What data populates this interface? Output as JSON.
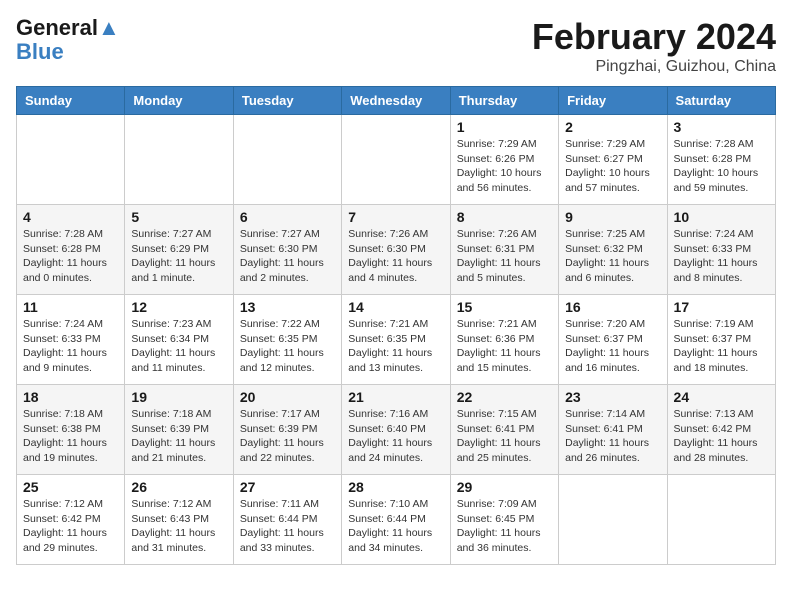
{
  "header": {
    "logo_line1": "General",
    "logo_line2": "Blue",
    "month_year": "February 2024",
    "location": "Pingzhai, Guizhou, China"
  },
  "days_of_week": [
    "Sunday",
    "Monday",
    "Tuesday",
    "Wednesday",
    "Thursday",
    "Friday",
    "Saturday"
  ],
  "weeks": [
    [
      {
        "day": "",
        "sunrise": "",
        "sunset": "",
        "daylight": ""
      },
      {
        "day": "",
        "sunrise": "",
        "sunset": "",
        "daylight": ""
      },
      {
        "day": "",
        "sunrise": "",
        "sunset": "",
        "daylight": ""
      },
      {
        "day": "",
        "sunrise": "",
        "sunset": "",
        "daylight": ""
      },
      {
        "day": "1",
        "sunrise": "7:29 AM",
        "sunset": "6:26 PM",
        "daylight": "10 hours and 56 minutes."
      },
      {
        "day": "2",
        "sunrise": "7:29 AM",
        "sunset": "6:27 PM",
        "daylight": "10 hours and 57 minutes."
      },
      {
        "day": "3",
        "sunrise": "7:28 AM",
        "sunset": "6:28 PM",
        "daylight": "10 hours and 59 minutes."
      }
    ],
    [
      {
        "day": "4",
        "sunrise": "7:28 AM",
        "sunset": "6:28 PM",
        "daylight": "11 hours and 0 minutes."
      },
      {
        "day": "5",
        "sunrise": "7:27 AM",
        "sunset": "6:29 PM",
        "daylight": "11 hours and 1 minute."
      },
      {
        "day": "6",
        "sunrise": "7:27 AM",
        "sunset": "6:30 PM",
        "daylight": "11 hours and 2 minutes."
      },
      {
        "day": "7",
        "sunrise": "7:26 AM",
        "sunset": "6:30 PM",
        "daylight": "11 hours and 4 minutes."
      },
      {
        "day": "8",
        "sunrise": "7:26 AM",
        "sunset": "6:31 PM",
        "daylight": "11 hours and 5 minutes."
      },
      {
        "day": "9",
        "sunrise": "7:25 AM",
        "sunset": "6:32 PM",
        "daylight": "11 hours and 6 minutes."
      },
      {
        "day": "10",
        "sunrise": "7:24 AM",
        "sunset": "6:33 PM",
        "daylight": "11 hours and 8 minutes."
      }
    ],
    [
      {
        "day": "11",
        "sunrise": "7:24 AM",
        "sunset": "6:33 PM",
        "daylight": "11 hours and 9 minutes."
      },
      {
        "day": "12",
        "sunrise": "7:23 AM",
        "sunset": "6:34 PM",
        "daylight": "11 hours and 11 minutes."
      },
      {
        "day": "13",
        "sunrise": "7:22 AM",
        "sunset": "6:35 PM",
        "daylight": "11 hours and 12 minutes."
      },
      {
        "day": "14",
        "sunrise": "7:21 AM",
        "sunset": "6:35 PM",
        "daylight": "11 hours and 13 minutes."
      },
      {
        "day": "15",
        "sunrise": "7:21 AM",
        "sunset": "6:36 PM",
        "daylight": "11 hours and 15 minutes."
      },
      {
        "day": "16",
        "sunrise": "7:20 AM",
        "sunset": "6:37 PM",
        "daylight": "11 hours and 16 minutes."
      },
      {
        "day": "17",
        "sunrise": "7:19 AM",
        "sunset": "6:37 PM",
        "daylight": "11 hours and 18 minutes."
      }
    ],
    [
      {
        "day": "18",
        "sunrise": "7:18 AM",
        "sunset": "6:38 PM",
        "daylight": "11 hours and 19 minutes."
      },
      {
        "day": "19",
        "sunrise": "7:18 AM",
        "sunset": "6:39 PM",
        "daylight": "11 hours and 21 minutes."
      },
      {
        "day": "20",
        "sunrise": "7:17 AM",
        "sunset": "6:39 PM",
        "daylight": "11 hours and 22 minutes."
      },
      {
        "day": "21",
        "sunrise": "7:16 AM",
        "sunset": "6:40 PM",
        "daylight": "11 hours and 24 minutes."
      },
      {
        "day": "22",
        "sunrise": "7:15 AM",
        "sunset": "6:41 PM",
        "daylight": "11 hours and 25 minutes."
      },
      {
        "day": "23",
        "sunrise": "7:14 AM",
        "sunset": "6:41 PM",
        "daylight": "11 hours and 26 minutes."
      },
      {
        "day": "24",
        "sunrise": "7:13 AM",
        "sunset": "6:42 PM",
        "daylight": "11 hours and 28 minutes."
      }
    ],
    [
      {
        "day": "25",
        "sunrise": "7:12 AM",
        "sunset": "6:42 PM",
        "daylight": "11 hours and 29 minutes."
      },
      {
        "day": "26",
        "sunrise": "7:12 AM",
        "sunset": "6:43 PM",
        "daylight": "11 hours and 31 minutes."
      },
      {
        "day": "27",
        "sunrise": "7:11 AM",
        "sunset": "6:44 PM",
        "daylight": "11 hours and 33 minutes."
      },
      {
        "day": "28",
        "sunrise": "7:10 AM",
        "sunset": "6:44 PM",
        "daylight": "11 hours and 34 minutes."
      },
      {
        "day": "29",
        "sunrise": "7:09 AM",
        "sunset": "6:45 PM",
        "daylight": "11 hours and 36 minutes."
      },
      {
        "day": "",
        "sunrise": "",
        "sunset": "",
        "daylight": ""
      },
      {
        "day": "",
        "sunrise": "",
        "sunset": "",
        "daylight": ""
      }
    ]
  ]
}
